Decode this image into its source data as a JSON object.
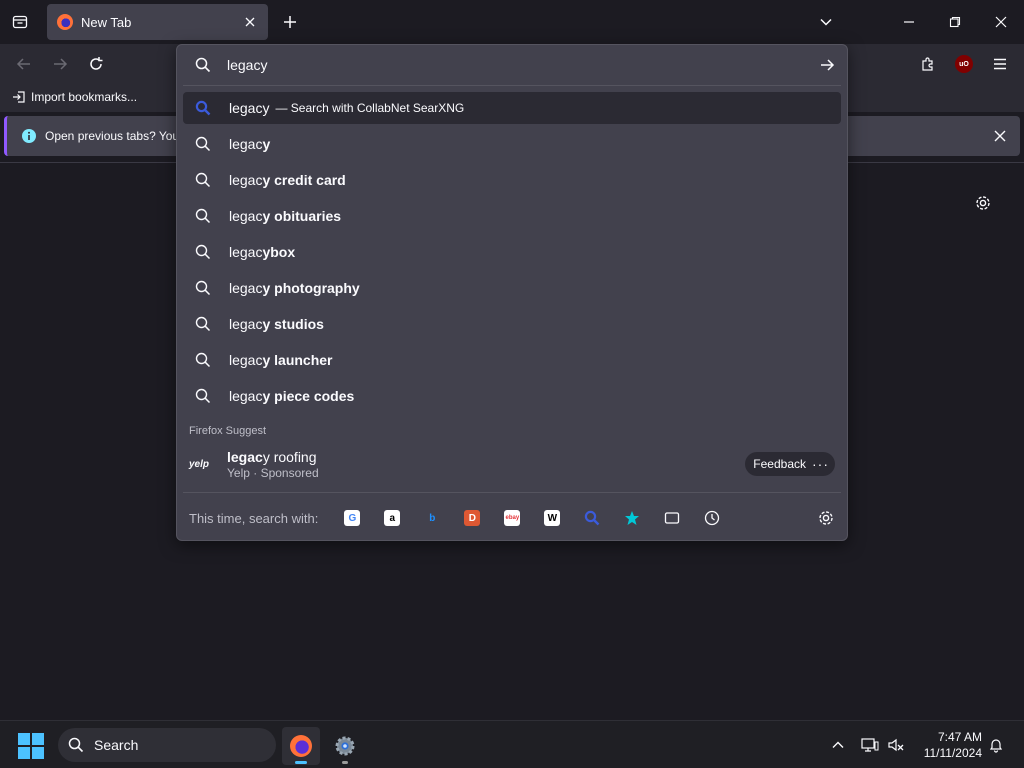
{
  "tab": {
    "title": "New Tab"
  },
  "bookmarks": {
    "import_label": "Import bookmarks..."
  },
  "notification": {
    "text": "Open previous tabs? You c"
  },
  "urlbar": {
    "value": "legacy",
    "first_result": {
      "typed": "legacy",
      "action": "— Search with CollabNet SearXNG"
    },
    "suggestions": [
      {
        "typed": "legac",
        "suffix": "y"
      },
      {
        "typed": "legac",
        "suffix": "y credit card"
      },
      {
        "typed": "legac",
        "suffix": "y obituaries"
      },
      {
        "typed": "legac",
        "suffix": "ybox"
      },
      {
        "typed": "legac",
        "suffix": "y photography"
      },
      {
        "typed": "legac",
        "suffix": "y studios"
      },
      {
        "typed": "legac",
        "suffix": "y launcher"
      },
      {
        "typed": "legac",
        "suffix": "y piece codes"
      }
    ],
    "suggest_header": "Firefox Suggest",
    "sponsored": {
      "logo": "yelp",
      "title_bold": "legac",
      "title_rest": "y roofing",
      "subtitle": "Yelp · Sponsored",
      "feedback_label": "Feedback",
      "more": "···"
    },
    "one_off": {
      "label": "This time, search with:",
      "engines": [
        {
          "name": "google-engine-icon",
          "glyph": "G",
          "color": "#4285f4",
          "bg": "#ffffff"
        },
        {
          "name": "amazon-engine-icon",
          "glyph": "a",
          "color": "#000000",
          "bg": "#ffffff"
        },
        {
          "name": "bing-engine-icon",
          "glyph": "b",
          "color": "#1e90ff",
          "bg": "transparent"
        },
        {
          "name": "duckduckgo-engine-icon",
          "glyph": "D",
          "color": "#ffffff",
          "bg": "#de5833"
        },
        {
          "name": "ebay-engine-icon",
          "glyph": "ebay",
          "color": "#e53238",
          "bg": "#ffffff"
        },
        {
          "name": "wikipedia-engine-icon",
          "glyph": "W",
          "color": "#000000",
          "bg": "#ffffff"
        }
      ]
    }
  },
  "taskbar": {
    "search_label": "Search",
    "time": "7:47 AM",
    "date": "11/11/2024"
  },
  "colors": {
    "accent": "#4cc2ff",
    "panel": "#42414d",
    "selected": "#2b2a33",
    "searx": "#3b5bdb"
  }
}
